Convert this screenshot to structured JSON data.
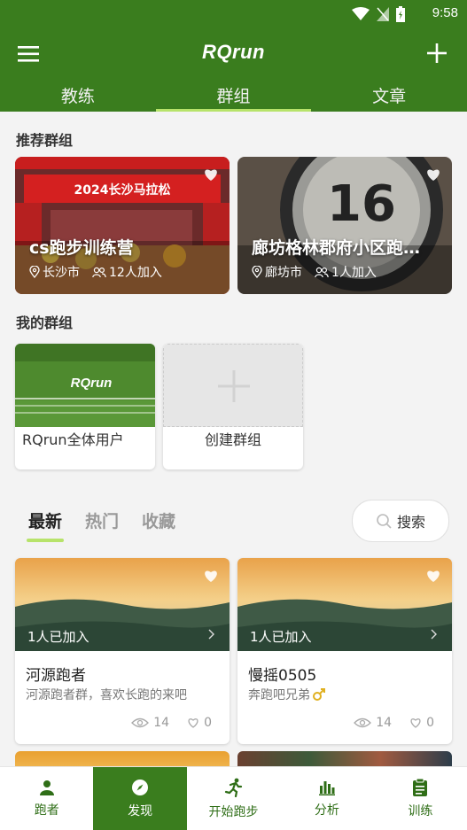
{
  "status": {
    "time": "9:58"
  },
  "app": {
    "title": "RQrun"
  },
  "tabs": [
    {
      "label": "教练"
    },
    {
      "label": "群组"
    },
    {
      "label": "文章"
    }
  ],
  "sections": {
    "recommended": "推荐群组",
    "mine": "我的群组"
  },
  "recommended_groups": [
    {
      "name": "cs跑步训练营",
      "location": "长沙市",
      "members": "12人加入",
      "banner": "2024长沙马拉松"
    },
    {
      "name": "廊坊格林郡府小区跑…",
      "location": "廊坊市",
      "members": "1人加入"
    }
  ],
  "my_groups": [
    {
      "label": "RQrun全体用户",
      "logo_text": "RQrun"
    },
    {
      "label": "创建群组"
    }
  ],
  "feed_tabs": [
    {
      "label": "最新"
    },
    {
      "label": "热门"
    },
    {
      "label": "收藏"
    }
  ],
  "search": {
    "label": "搜索"
  },
  "posts": [
    {
      "joined": "1人已加入",
      "title": "河源跑者",
      "desc": "河源跑者群，喜欢长跑的来吧",
      "views": "14",
      "likes": "0"
    },
    {
      "joined": "1人已加入",
      "title": "慢摇0505",
      "desc": "奔跑吧兄弟",
      "views": "14",
      "likes": "0"
    }
  ],
  "bottom_nav": [
    {
      "label": "跑者",
      "icon": "person-icon"
    },
    {
      "label": "发现",
      "icon": "compass-icon"
    },
    {
      "label": "开始跑步",
      "icon": "running-icon"
    },
    {
      "label": "分析",
      "icon": "bar-chart-icon"
    },
    {
      "label": "训练",
      "icon": "clipboard-icon"
    }
  ],
  "colors": {
    "primary": "#3a7d1e",
    "accent": "#b7e36a"
  }
}
